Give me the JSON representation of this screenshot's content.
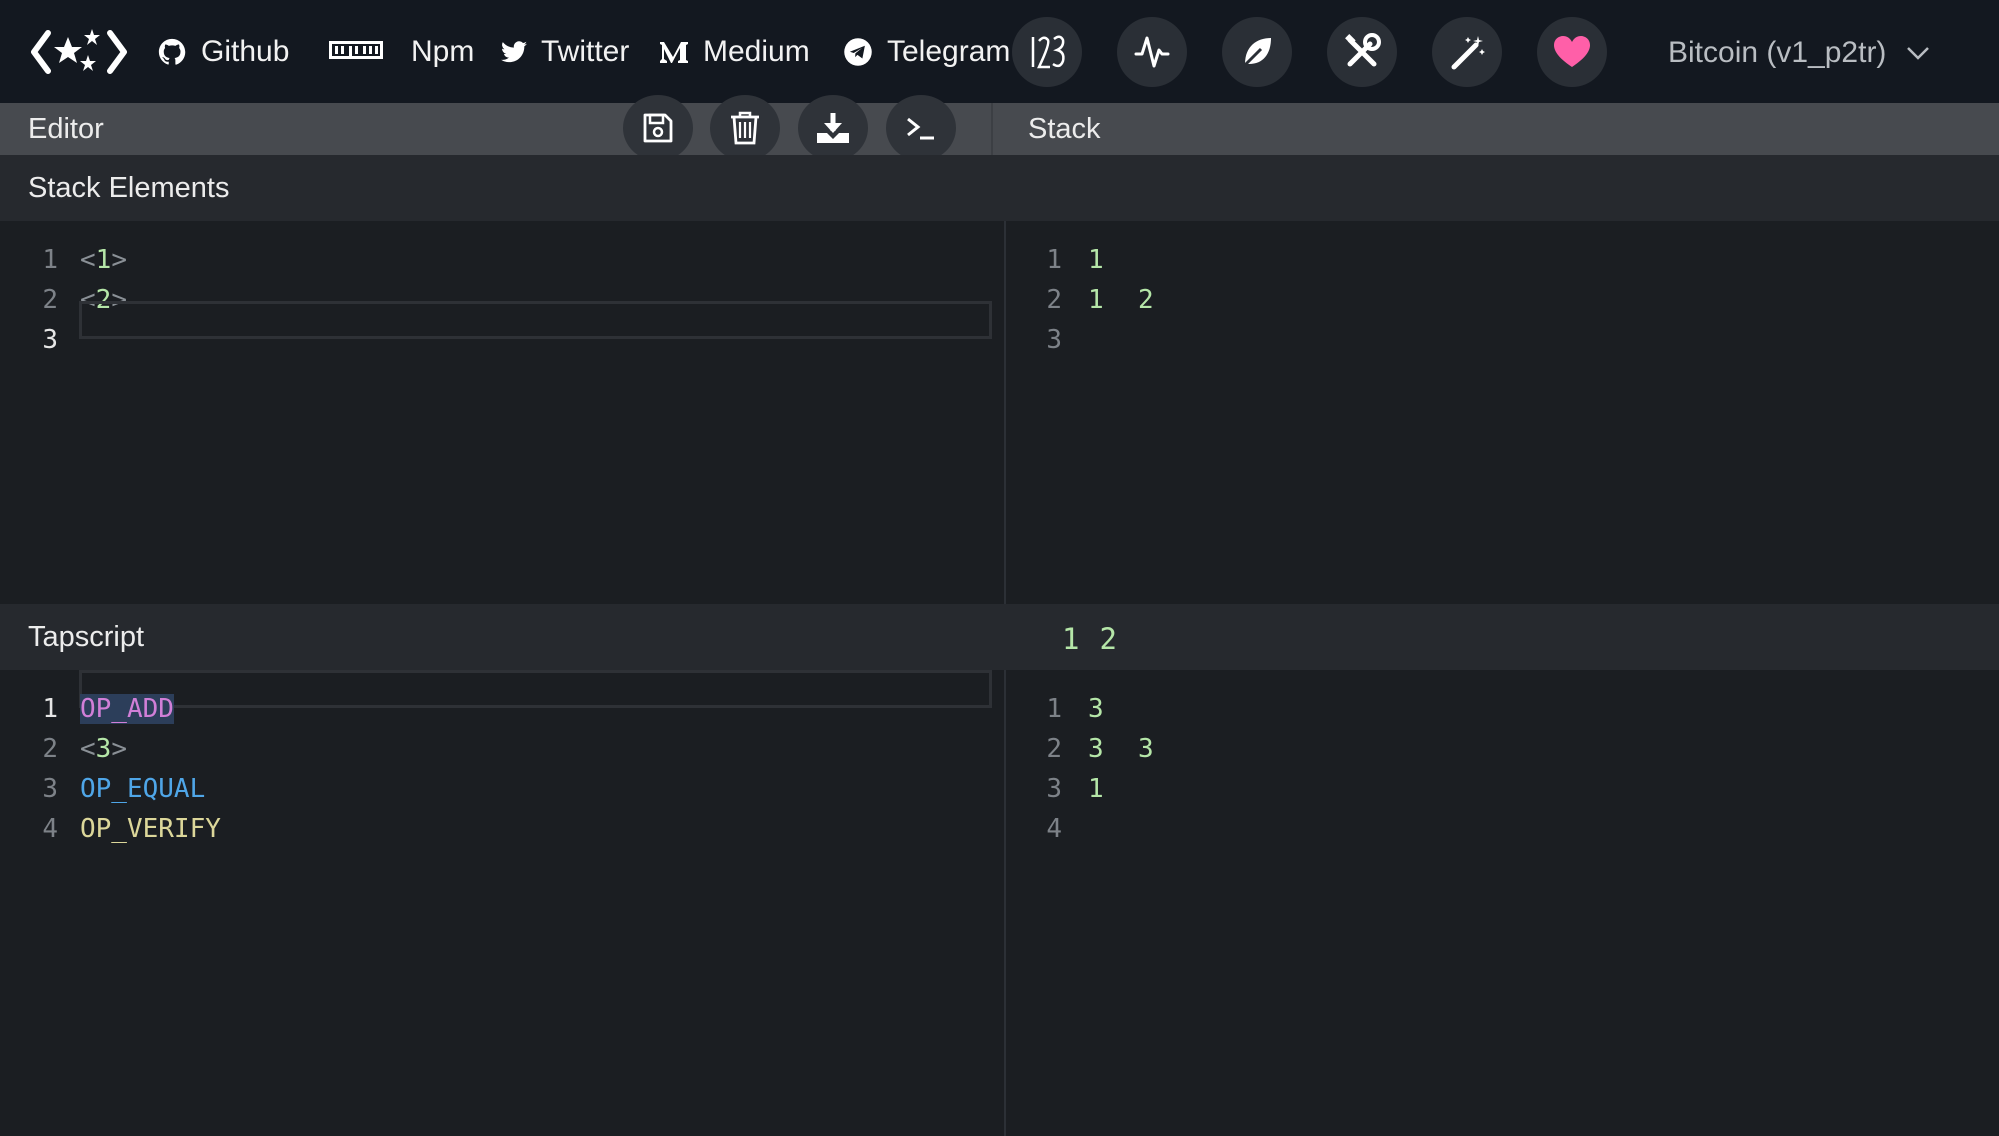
{
  "nav": {
    "links": [
      {
        "label": "Github",
        "icon": "github-icon"
      },
      {
        "label": "Npm",
        "icon": "npm-icon"
      },
      {
        "label": "Twitter",
        "icon": "twitter-icon"
      },
      {
        "label": "Medium",
        "icon": "medium-icon"
      },
      {
        "label": "Telegram",
        "icon": "telegram-icon"
      }
    ],
    "icon_buttons": [
      "numbers-icon",
      "pulse-icon",
      "leaf-icon",
      "tools-icon",
      "magic-wand-icon",
      "heart-icon"
    ],
    "network": "Bitcoin (v1_p2tr)",
    "heart_color": "#ff5fa8"
  },
  "header": {
    "editor": "Editor",
    "stack": "Stack",
    "tools": [
      "save-icon",
      "trash-icon",
      "download-icon",
      "terminal-icon"
    ]
  },
  "stack_elements": {
    "title": "Stack Elements",
    "lines": [
      {
        "n": "1",
        "value": "1"
      },
      {
        "n": "2",
        "value": "2"
      },
      {
        "n": "3",
        "value": ""
      }
    ],
    "stack_lines": [
      {
        "n": "1",
        "text": "1"
      },
      {
        "n": "2",
        "text": "1  2"
      },
      {
        "n": "3",
        "text": ""
      }
    ]
  },
  "tapscript": {
    "title": "Tapscript",
    "initial_stack": [
      "1",
      "2"
    ],
    "lines": [
      {
        "n": "1",
        "text": "OP_ADD"
      },
      {
        "n": "2",
        "text": "3"
      },
      {
        "n": "3",
        "text": "OP_EQUAL"
      },
      {
        "n": "4",
        "text": "OP_VERIFY"
      }
    ],
    "stack_lines": [
      {
        "n": "1",
        "text": "3"
      },
      {
        "n": "2",
        "text": "3  3"
      },
      {
        "n": "3",
        "text": "1"
      },
      {
        "n": "4",
        "text": ""
      }
    ]
  }
}
